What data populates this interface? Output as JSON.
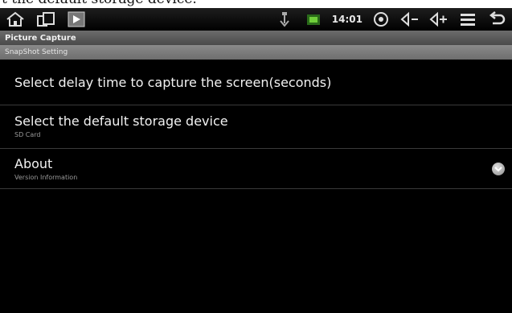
{
  "caption": {
    "text": "t the default storage device."
  },
  "status_bar": {
    "time": "14:01",
    "icons": [
      "home-icon",
      "recent-apps-icon",
      "screenshot-icon",
      "usb-icon",
      "battery-icon",
      "eye-icon",
      "volume-down-icon",
      "volume-up-icon",
      "menu-icon",
      "back-icon"
    ]
  },
  "app": {
    "title": "Picture Capture"
  },
  "section": {
    "header": "SnapShot Setting"
  },
  "settings": {
    "items": [
      {
        "title": "Select delay time to capture the screen(seconds)",
        "subtitle": ""
      },
      {
        "title": "Select the default storage device",
        "subtitle": "SD Card"
      },
      {
        "title": "About",
        "subtitle": "Version Information"
      }
    ]
  },
  "colors": {
    "status_bar": "#000000",
    "title_bar": "#5a5a5a",
    "section_header": "#7c7c7c",
    "background": "#000000",
    "text": "#f2f2f2"
  }
}
